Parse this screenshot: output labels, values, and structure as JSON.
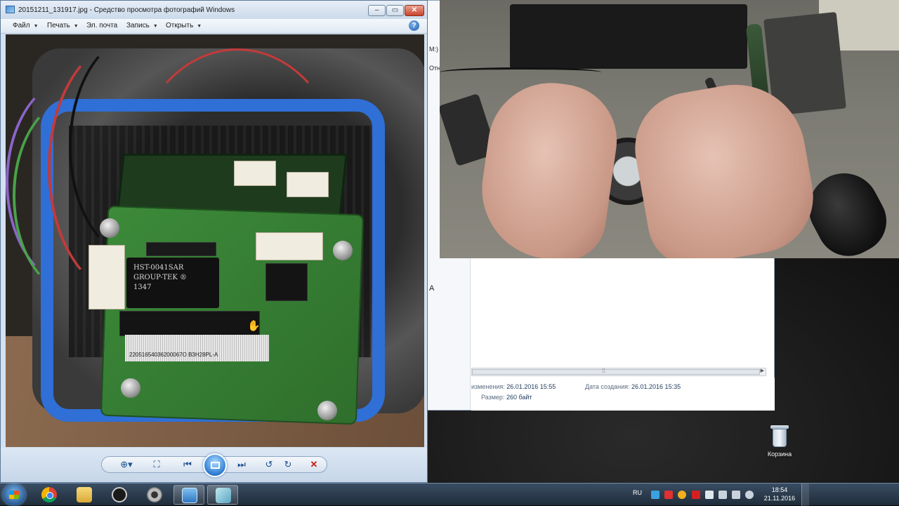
{
  "viewer": {
    "title": "20151211_131917.jpg - Средство просмотра фотографий Windows",
    "caption_buttons": {
      "minimize": "–",
      "maximize": "▭",
      "close": "✕"
    },
    "menu": [
      {
        "label": "Файл",
        "has_caret": true
      },
      {
        "label": "Печать",
        "has_caret": true
      },
      {
        "label": "Эл. почта",
        "has_caret": false
      },
      {
        "label": "Запись",
        "has_caret": true
      },
      {
        "label": "Открыть",
        "has_caret": true
      }
    ],
    "help_label": "?",
    "photo": {
      "transformer_text": [
        "HST-0041SAR",
        "GROUP-TEK ®",
        "1347"
      ],
      "barcode_text": "22051654036200067O B3H28PL-A"
    },
    "toolbar": {
      "zoom_icon": "zoom-icon",
      "fit_icon": "fit-to-window-icon",
      "prev_icon": "previous-icon",
      "slideshow_icon": "slideshow-icon",
      "next_icon": "next-icon",
      "rotate_ccw_icon": "rotate-counterclockwise-icon",
      "rotate_cw_icon": "rotate-clockwise-icon",
      "delete_icon": "delete-icon"
    }
  },
  "explorer": {
    "fragments": [
      "M:)",
      "Отн",
      "A"
    ],
    "details": {
      "modified_label": "изменения:",
      "modified_value": "26.01.2016 15:55",
      "created_label": "Дата создания:",
      "created_value": "26.01.2016 15:35",
      "size_label": "Размер:",
      "size_value": "260 байт"
    }
  },
  "desktop": {
    "recycle_bin_label": "Корзина"
  },
  "taskbar": {
    "apps": [
      "chrome-icon",
      "explorer-icon",
      "obs-icon",
      "webcam-icon",
      "photo-viewer-icon",
      "app-icon"
    ],
    "tray": {
      "language": "RU",
      "time": "18:54",
      "date": "21.11.2016"
    }
  },
  "colors": {
    "gasket": "#2f6fd6",
    "pcb": "#3c8a3a",
    "close_button": "#c9432b",
    "delete": "#d21b12"
  }
}
